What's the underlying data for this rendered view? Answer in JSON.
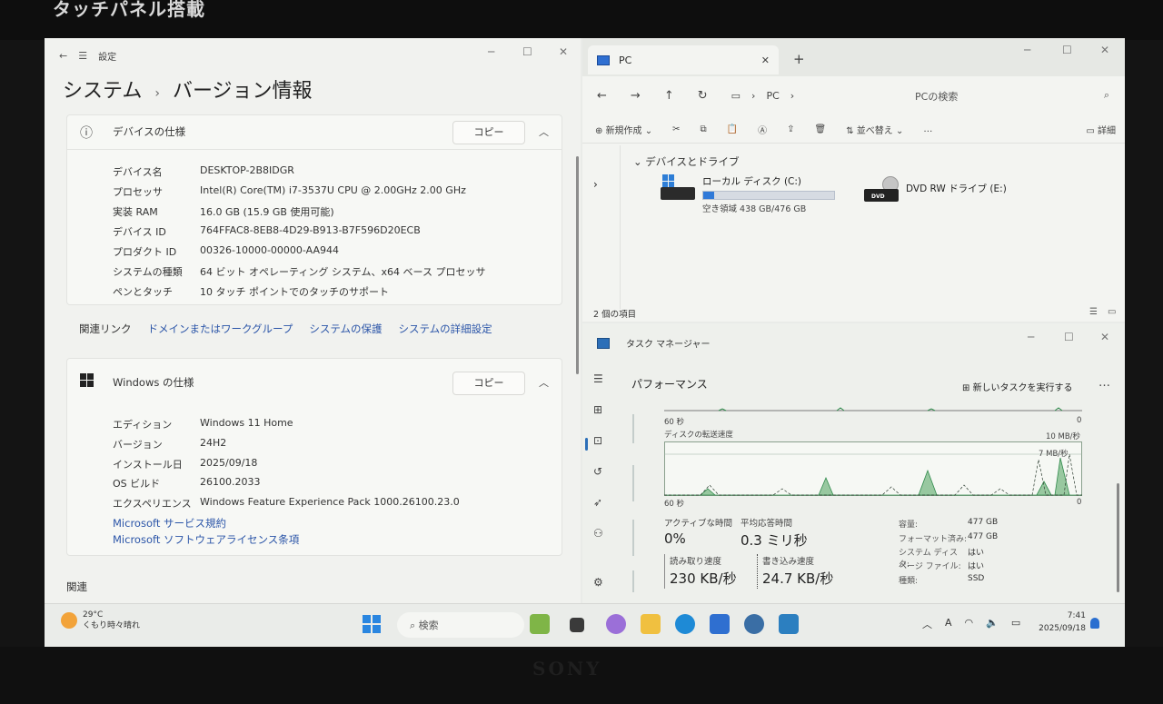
{
  "bezel": {
    "label": "タッチパネル搭載",
    "brand": "SONY"
  },
  "settings": {
    "app_name": "設定",
    "breadcrumb": [
      "システム",
      "バージョン情報"
    ],
    "device_card": {
      "title": "デバイスの仕様",
      "copy_label": "コピー",
      "specs": [
        {
          "key": "デバイス名",
          "value": "DESKTOP-2B8IDGR"
        },
        {
          "key": "プロセッサ",
          "value": "Intel(R) Core(TM) i7-3537U CPU @ 2.00GHz   2.00 GHz"
        },
        {
          "key": "実装 RAM",
          "value": "16.0 GB (15.9 GB 使用可能)"
        },
        {
          "key": "デバイス ID",
          "value": "764FFAC8-8EB8-4D29-B913-B7F596D20ECB"
        },
        {
          "key": "プロダクト ID",
          "value": "00326-10000-00000-AA944"
        },
        {
          "key": "システムの種類",
          "value": "64 ビット オペレーティング システム、x64 ベース プロセッサ"
        },
        {
          "key": "ペンとタッチ",
          "value": "10 タッチ ポイントでのタッチのサポート"
        }
      ]
    },
    "related_links": {
      "label": "関連リンク",
      "links": [
        "ドメインまたはワークグループ",
        "システムの保護",
        "システムの詳細設定"
      ]
    },
    "windows_card": {
      "title": "Windows の仕様",
      "copy_label": "コピー",
      "specs": [
        {
          "key": "エディション",
          "value": "Windows 11 Home"
        },
        {
          "key": "バージョン",
          "value": "24H2"
        },
        {
          "key": "インストール日",
          "value": "2025/09/18"
        },
        {
          "key": "OS ビルド",
          "value": "26100.2033"
        },
        {
          "key": "エクスペリエンス",
          "value": "Windows Feature Experience Pack 1000.26100.23.0"
        }
      ],
      "links": [
        "Microsoft サービス規約",
        "Microsoft ソフトウェアライセンス条項"
      ]
    },
    "related_heading": "関連"
  },
  "explorer": {
    "tab_title": "PC",
    "breadcrumb": [
      "PC"
    ],
    "search_placeholder": "PCの検索",
    "toolbar": {
      "new": "新規作成",
      "sort": "並べ替え",
      "more": "…",
      "details": "詳細"
    },
    "group_title": "デバイスとドライブ",
    "drives": [
      {
        "name": "ローカル ディスク (C:)",
        "free_text": "空き領域 438 GB/476 GB",
        "used_fraction": 0.08
      },
      {
        "name": "DVD RW ドライブ (E:)",
        "badge": "DVD"
      }
    ],
    "status": "2 個の項目"
  },
  "taskmgr": {
    "title": "タスク マネージャー",
    "section": "パフォーマンス",
    "new_task": "新しいタスクを実行する",
    "top_graph": {
      "left_label": "60 秒",
      "right_label": "0"
    },
    "transfer_graph": {
      "title": "ディスクの転送速度",
      "max_label": "10 MB/秒",
      "second_label": "7 MB/秒",
      "left_label": "60 秒",
      "right_label": "0"
    },
    "active_time": {
      "label": "アクティブな時間",
      "value": "0%"
    },
    "avg_response": {
      "label": "平均応答時間",
      "value": "0.3 ミリ秒"
    },
    "read_speed": {
      "label": "読み取り速度",
      "value": "230 KB/秒"
    },
    "write_speed": {
      "label": "書き込み速度",
      "value": "24.7 KB/秒"
    },
    "properties": [
      {
        "key": "容量:",
        "value": "477 GB"
      },
      {
        "key": "フォーマット済み:",
        "value": "477 GB"
      },
      {
        "key": "システム ディスク:",
        "value": "はい"
      },
      {
        "key": "ページ ファイル:",
        "value": "はい"
      },
      {
        "key": "種類:",
        "value": "SSD"
      }
    ]
  },
  "taskbar": {
    "weather_temp": "29°C",
    "weather_desc": "くもり時々晴れ",
    "search_label": "検索",
    "clock_time": "7:41",
    "clock_date": "2025/09/18",
    "ime": "A"
  }
}
